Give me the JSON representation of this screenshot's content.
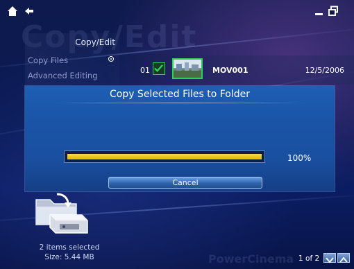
{
  "titlebar": {
    "home_icon": "home-icon",
    "back_icon": "back-arrow-icon",
    "minimize_icon": "minimize-icon",
    "restore_icon": "restore-window-icon"
  },
  "watermark": {
    "text": "Copy/Edit"
  },
  "left_menu": {
    "header": "Copy/Edit",
    "items": [
      {
        "label": "Copy Files",
        "selected": true
      },
      {
        "label": "Advanced Editing",
        "selected": false
      }
    ]
  },
  "file_row": {
    "index": "01",
    "checked": true,
    "name": "MOV001",
    "date": "12/5/2006"
  },
  "dialog": {
    "title": "Copy Selected Files to Folder",
    "progress": 1.0,
    "progress_label": "100%",
    "cancel_label": "Cancel"
  },
  "footer": {
    "selection_count": "2 items selected",
    "selection_size": "Size: 5.44 MB",
    "pager_text": "1 of 2",
    "brand": "PowerCinema"
  },
  "colors": {
    "accent_green": "#2fd058",
    "progress_yellow": "#e8b400",
    "dialog_blue": "#1a55a8",
    "background_navy": "#0b1540"
  }
}
